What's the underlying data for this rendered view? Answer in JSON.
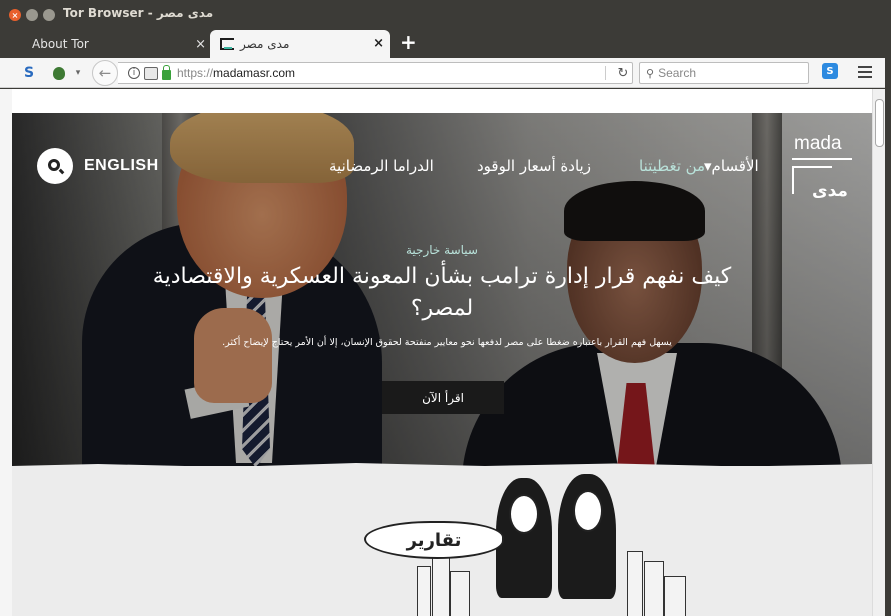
{
  "window": {
    "title": "Tor Browser - مدى مصر",
    "close_glyph": "×",
    "min_glyph": "",
    "max_glyph": ""
  },
  "tabs": [
    {
      "label": "About Tor",
      "close": "×"
    },
    {
      "label": "مدى مصر",
      "close": "×"
    }
  ],
  "new_tab": "+",
  "navbar": {
    "url_protocol": "https://",
    "url_host": "madamasr.com",
    "info_glyph": "i",
    "reload": "↻",
    "back": "←",
    "search_placeholder": "Search",
    "ext_label": "S",
    "s_icon": "S",
    "dropdown": "▾"
  },
  "site": {
    "lang_label": "ENGLISH",
    "nav": {
      "drama": "الدراما الرمضانية",
      "fuel": "زيادة أسعار الوقود",
      "from": "من تغطيتنا",
      "sections": "الأقسام▾"
    },
    "logo": {
      "en": "mada",
      "ar": "مدى"
    },
    "kicker": "سياسة خارجية",
    "headline": "كيف نفهم قرار إدارة ترامب بشأن المعونة العسكرية والاقتصادية لمصر؟",
    "dek": "يسهل فهم القرار باعتباره ضغطا على مصر لدفعها نحو معايير منفتحة لحقوق الإنسان، إلا أن الأمر يحتاج لإيضاح أكثر.",
    "read_button": "اقرأ الآن",
    "bubble": "تقارير"
  },
  "colors": {
    "accent": "#b9e2da",
    "chrome": "#3c3b37",
    "lock": "#39a13a",
    "close": "#e8602c"
  },
  "icons": [
    "search-icon",
    "onion-icon",
    "lock-icon",
    "info-icon",
    "reload-icon",
    "hamburger-menu-icon",
    "back-arrow-icon"
  ]
}
